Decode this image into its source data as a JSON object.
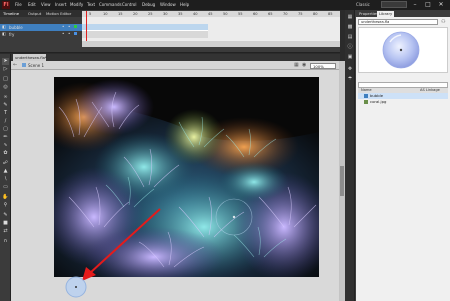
{
  "app": {
    "logo": "Fl"
  },
  "menu": [
    "File",
    "Edit",
    "View",
    "Insert",
    "Modify",
    "Text",
    "Commands",
    "Control",
    "Debug",
    "Window",
    "Help"
  ],
  "workspace": {
    "label": "Classic",
    "search": ""
  },
  "window_controls": {
    "minimize": "–",
    "maximize": "□",
    "close": "✕"
  },
  "timeline": {
    "tabs": [
      "Timeline",
      "Output",
      "Motion Editor"
    ],
    "frame_numbers": [
      "5",
      "10",
      "15",
      "20",
      "25",
      "30",
      "35",
      "40",
      "45",
      "50",
      "55",
      "60",
      "65",
      "70",
      "75",
      "80",
      "85"
    ],
    "layers": [
      {
        "name": "bubble",
        "selected": true
      },
      {
        "name": "fry",
        "selected": false
      }
    ]
  },
  "document": {
    "tab": "underthesea.fla*",
    "scene": "Scene 1",
    "zoom": "100%"
  },
  "tools": [
    "selection-tool",
    "subselection-tool",
    "free-transform-tool",
    "3d-rotation-tool",
    "lasso-tool",
    "pen-tool",
    "text-tool",
    "line-tool",
    "rectangle-tool",
    "pencil-tool",
    "brush-tool",
    "deco-tool",
    "bone-tool",
    "paint-bucket-tool",
    "eyedropper-tool",
    "eraser-tool",
    "hand-tool",
    "zoom-tool",
    "stroke-color",
    "fill-color",
    "swap-colors",
    "snap-to-objects"
  ],
  "library": {
    "tabs": [
      "Properties",
      "Library"
    ],
    "document": "underthesea.fla",
    "items_count": "",
    "columns": {
      "name": "Name",
      "linkage": "AS Linkage"
    },
    "items": [
      {
        "name": "bubble",
        "type": "movie-clip",
        "selected": true
      },
      {
        "name": "coral.jpg",
        "type": "bitmap",
        "selected": false
      }
    ]
  },
  "colors": {
    "selection_blue": "#3f7fbf",
    "stage_grey": "#d9d9d9",
    "panel_dark": "#3b3b3b",
    "arrow_red": "#e41b1b"
  }
}
